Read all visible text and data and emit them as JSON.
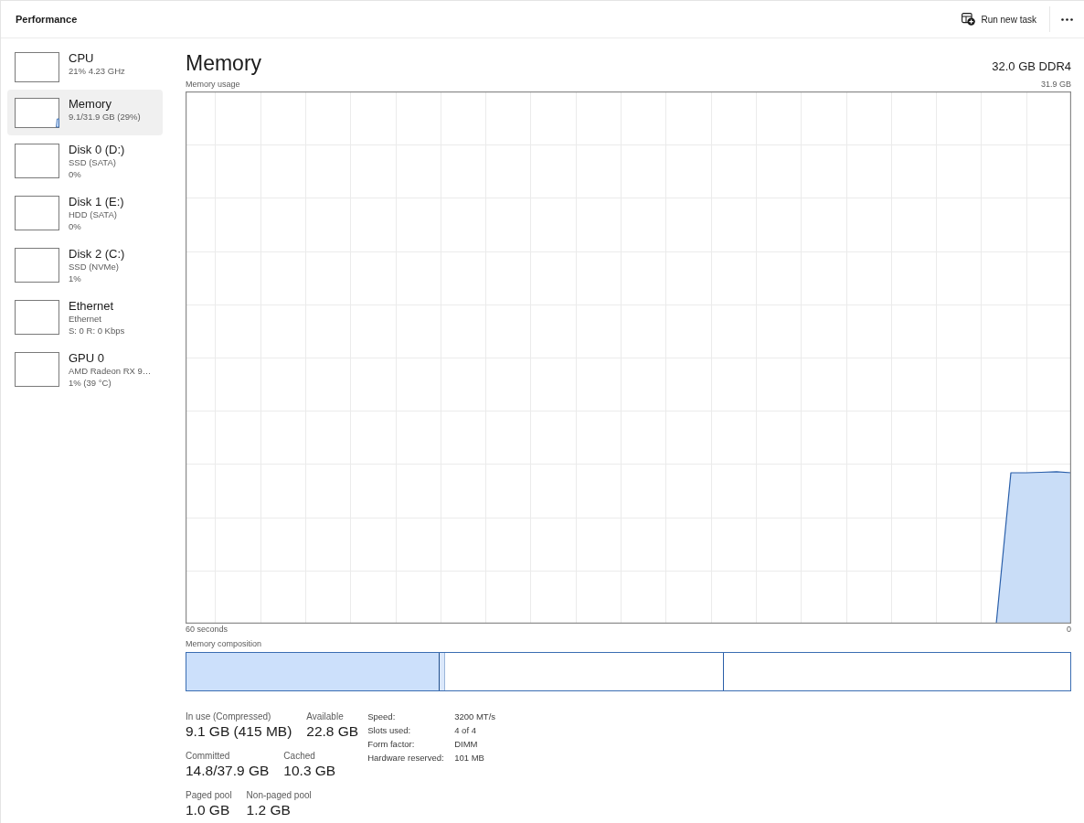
{
  "header": {
    "title": "Performance",
    "run_task": {
      "label": "Run new task"
    }
  },
  "sidebar": {
    "items": [
      {
        "title": "CPU",
        "details": [
          "21% 4.23 GHz"
        ],
        "selected": false
      },
      {
        "title": "Memory",
        "details": [
          "9.1/31.9 GB (29%)"
        ],
        "selected": true
      },
      {
        "title": "Disk 0 (D:)",
        "details": [
          "SSD (SATA)",
          "0%"
        ],
        "selected": false
      },
      {
        "title": "Disk 1 (E:)",
        "details": [
          "HDD (SATA)",
          "0%"
        ],
        "selected": false
      },
      {
        "title": "Disk 2 (C:)",
        "details": [
          "SSD (NVMe)",
          "1%"
        ],
        "selected": false
      },
      {
        "title": "Ethernet",
        "details": [
          "Ethernet",
          "S: 0 R: 0 Kbps"
        ],
        "selected": false
      },
      {
        "title": "GPU 0",
        "details": [
          "AMD Radeon RX 9…",
          "1% (39 °C)"
        ],
        "selected": false
      }
    ]
  },
  "main": {
    "title": "Memory",
    "capacity": "32.0 GB DDR4",
    "usage_graph": {
      "title": "Memory usage",
      "max_label": "31.9 GB",
      "start_label": "60 seconds",
      "end_label": "0"
    },
    "composition": {
      "label": "Memory composition",
      "segments": [
        {
          "kind": "filled",
          "level": 0.286
        },
        {
          "kind": "tinted",
          "level": 0.293
        },
        {
          "kind": "empty",
          "level": 0.608
        }
      ]
    },
    "stats": [
      [
        {
          "label": "In use (Compressed)",
          "value": "9.1 GB (415 MB)"
        },
        {
          "label": "Available",
          "value": "22.8 GB"
        }
      ],
      [
        {
          "label": "Committed",
          "value": "14.8/37.9 GB"
        },
        {
          "label": "Cached",
          "value": "10.3 GB"
        }
      ],
      [
        {
          "label": "Paged pool",
          "value": "1.0 GB"
        },
        {
          "label": "Non-paged pool",
          "value": "1.2 GB"
        }
      ]
    ],
    "specs": [
      {
        "label": "Speed:",
        "value": "3200 MT/s"
      },
      {
        "label": "Slots used:",
        "value": "4 of 4"
      },
      {
        "label": "Form factor:",
        "value": "DIMM"
      },
      {
        "label": "Hardware reserved:",
        "value": "101 MB"
      }
    ]
  }
}
